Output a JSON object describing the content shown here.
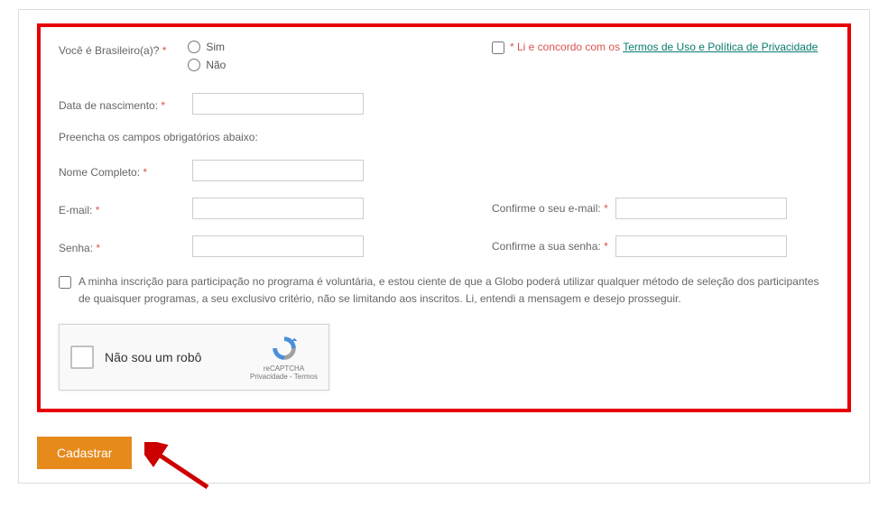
{
  "form": {
    "brazilian": {
      "label": "Você é Brasileiro(a)?",
      "option_yes": "Sim",
      "option_no": "Não"
    },
    "terms": {
      "prefix": "* Li e concordo com os ",
      "link": "Termos de Uso e Política de Privacidade"
    },
    "birthdate_label": "Data de nascimento:",
    "section_note": "Preencha os campos obrigatórios abaixo:",
    "fullname_label": "Nome Completo:",
    "email_label": "E-mail:",
    "confirm_email_label": "Confirme o seu e-mail:",
    "password_label": "Senha:",
    "confirm_password_label": "Confirme a sua senha:",
    "consent_text": "A minha inscrição para participação no programa é voluntária, e estou ciente de que a Globo poderá utilizar qualquer método de seleção dos participantes de quaisquer programas, a seu exclusivo critério, não se limitando aos inscritos. Li, entendi a mensagem e desejo prosseguir.",
    "recaptcha": {
      "label": "Não sou um robô",
      "brand": "reCAPTCHA",
      "links": "Privacidade - Termos"
    },
    "submit_label": "Cadastrar"
  }
}
